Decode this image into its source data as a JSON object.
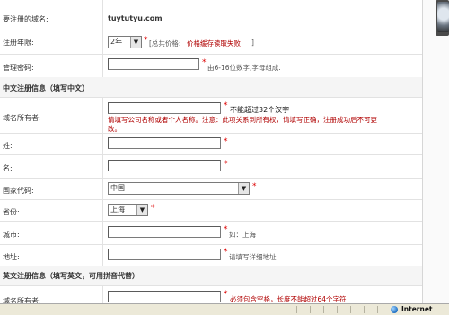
{
  "form": {
    "domain_label": "要注册的域名:",
    "domain_value": "tuytutyu.com",
    "years_label": "注册年限:",
    "years_value": "2年",
    "price_note": "[总共价格:",
    "price_error": "价格缓存读取失败!",
    "price_close": "]",
    "password_label": "管理密码:",
    "password_hint": "由6-16位数字,字母组成.",
    "cn_section": "中文注册信息（填写中文）",
    "owner_label": "域名所有者:",
    "owner_limit": "不能超过32个汉字",
    "owner_warning_1": "请填写公司名称或者个人名称。注意：此项关系到所有权，请填写正确，注册成功后不可更",
    "owner_warning_2": "改。",
    "surname_label": "姓:",
    "name_label": "名:",
    "country_label": "国家代码:",
    "country_value": "中国",
    "province_label": "省份:",
    "province_value": "上海",
    "city_label": "城市:",
    "city_hint": "如：上海",
    "address_label": "地址:",
    "address_hint": "请填写详细地址",
    "en_section": "英文注册信息（填写英文，可用拼音代替）",
    "en_owner_label": "域名所有者:",
    "en_owner_hint": "必须包含空格，长度不能超过64个字符",
    "required_mark": "*"
  },
  "statusbar": {
    "zone": "Internet"
  }
}
